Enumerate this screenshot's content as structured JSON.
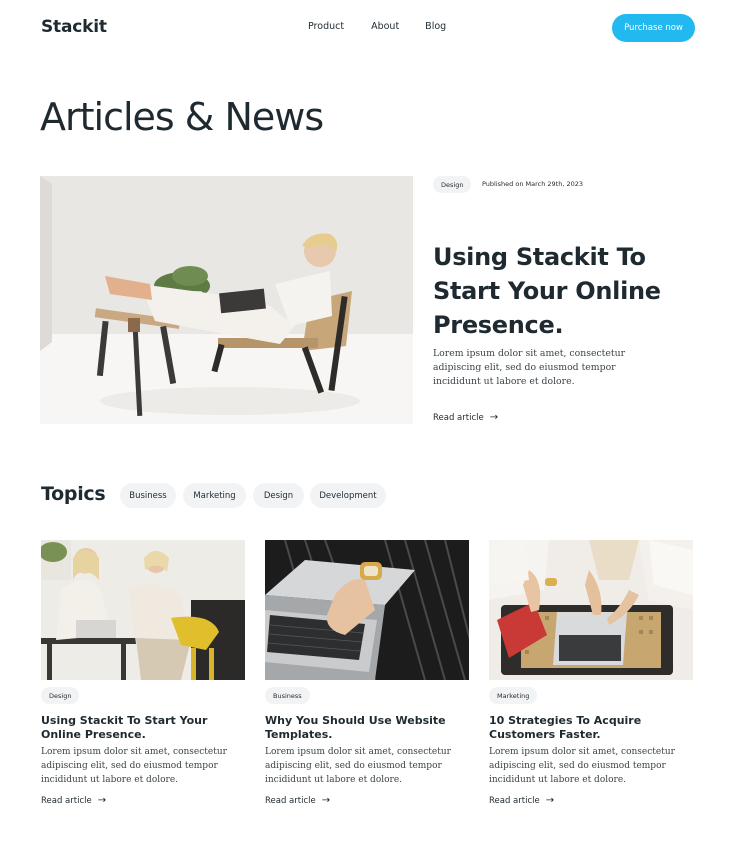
{
  "header": {
    "logo": "Stackit",
    "nav": [
      "Product",
      "About",
      "Blog"
    ],
    "cta": "Purchase now"
  },
  "page_title": "Articles & News",
  "featured": {
    "tag": "Design",
    "date": "Published on March 29th, 2023",
    "title": "Using Stackit To Start Your Online Presence.",
    "body": "Lorem ipsum dolor sit amet, consectetur adipiscing elit, sed do eiusmod tempor incididunt ut labore et dolore.",
    "read_label": "Read article",
    "image": "woman-lounging-laptop-photo"
  },
  "topics": {
    "title": "Topics",
    "chips": [
      "Business",
      "Marketing",
      "Design",
      "Development"
    ]
  },
  "cards": [
    {
      "tag": "Design",
      "title": "Using Stackit To Start Your Online Presence.",
      "body": "Lorem ipsum dolor sit amet, consectetur adipiscing elit, sed do eiusmod tempor incididunt ut labore et dolore.",
      "read_label": "Read article",
      "image": "two-women-working-photo"
    },
    {
      "tag": "Business",
      "title": "Why You Should Use Website Templates.",
      "body": "Lorem ipsum dolor sit amet, consectetur adipiscing elit, sed do eiusmod tempor incididunt ut labore et dolore.",
      "read_label": "Read article",
      "image": "hands-typing-laptop-photo"
    },
    {
      "tag": "Marketing",
      "title": "10 Strategies To Acquire Customers Faster.",
      "body": "Lorem ipsum dolor sit amet, consectetur adipiscing elit, sed do eiusmod tempor incididunt ut labore et dolore.",
      "read_label": "Read article",
      "image": "team-hands-table-photo"
    }
  ],
  "colors": {
    "accent": "#22b8f0",
    "text": "#1f2a30",
    "chip_bg": "#f2f3f4"
  }
}
